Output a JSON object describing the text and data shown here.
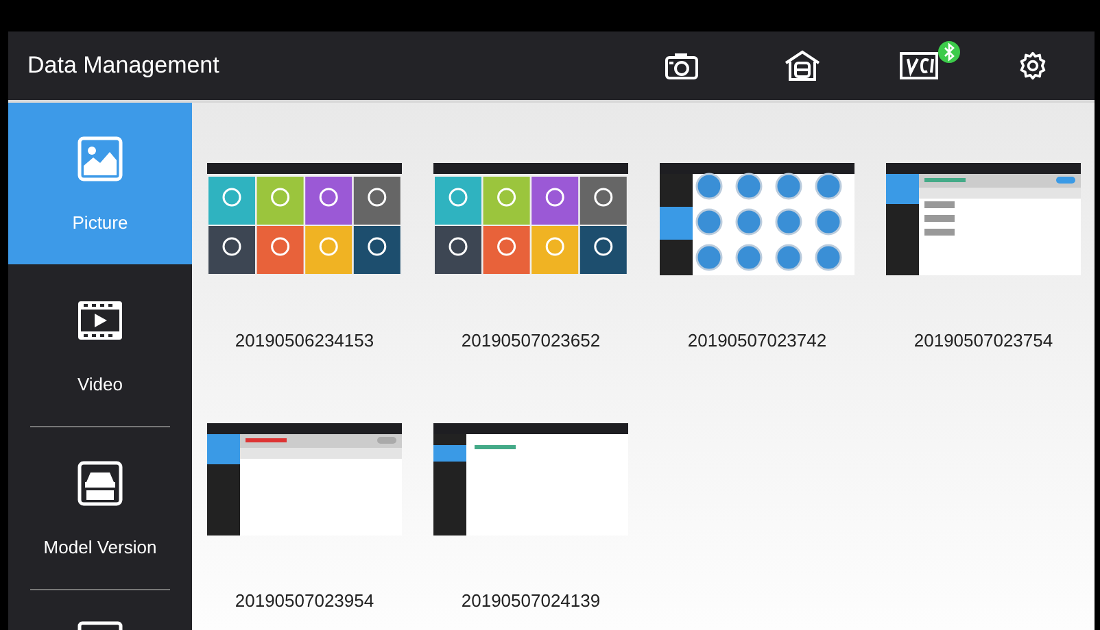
{
  "header": {
    "title": "Data Management",
    "bluetooth_connected": true
  },
  "sidebar": {
    "items": [
      {
        "kind": "picture",
        "label": "Picture",
        "selected": true
      },
      {
        "kind": "video",
        "label": "Video",
        "selected": false
      },
      {
        "kind": "model",
        "label": "Model Version",
        "selected": false
      },
      {
        "kind": "monitor",
        "selected": false
      }
    ]
  },
  "files": [
    {
      "kind": "home-menu",
      "name": "20190506234153"
    },
    {
      "kind": "home-menu",
      "name": "20190507023652"
    },
    {
      "kind": "vehicle-grid",
      "name": "20190507023742"
    },
    {
      "kind": "device-list-on",
      "name": "20190507023754"
    },
    {
      "kind": "device-list-off",
      "name": "20190507023954"
    },
    {
      "kind": "status-page",
      "name": "20190507024139"
    }
  ]
}
